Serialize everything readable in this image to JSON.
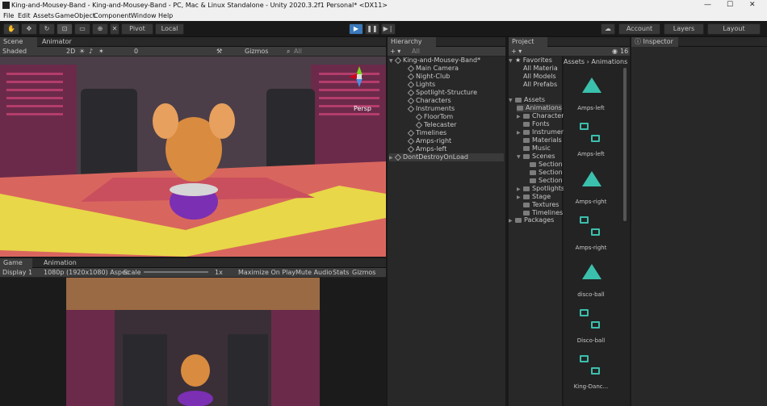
{
  "window": {
    "title": "King-and-Mousey-Band - King-and-Mousey-Band - PC, Mac & Linux Standalone - Unity 2020.3.2f1 Personal* <DX11>",
    "minimize": "—",
    "maximize": "☐",
    "close": "✕"
  },
  "menu": [
    "File",
    "Edit",
    "Assets",
    "GameObject",
    "Component",
    "Window",
    "Help"
  ],
  "toolbar": {
    "pivot": "Pivot",
    "local": "Local",
    "account": "Account",
    "layers": "Layers",
    "layout": "Layout"
  },
  "scene": {
    "tabs": [
      "Scene",
      "Animator"
    ],
    "shading": "Shaded",
    "mode_2d": "2D",
    "fx_count": "0",
    "gizmos": "Gizmos",
    "search_all": "All",
    "persp": "Persp"
  },
  "game": {
    "tabs": [
      "Game",
      "Animation"
    ],
    "display": "Display 1",
    "resolution": "1080p (1920x1080) Aspec",
    "scale_label": "Scale",
    "scale_value": "1x",
    "maximize": "Maximize On Play",
    "mute": "Mute Audio",
    "stats": "Stats",
    "gizmos": "Gizmos"
  },
  "hierarchy": {
    "tab": "Hierarchy",
    "search": "All",
    "items": [
      {
        "label": "King-and-Mousey-Band*",
        "depth": 0,
        "kind": "scene"
      },
      {
        "label": "Main Camera",
        "depth": 1,
        "kind": "go"
      },
      {
        "label": "Night-Club",
        "depth": 1,
        "kind": "go"
      },
      {
        "label": "Lights",
        "depth": 1,
        "kind": "go"
      },
      {
        "label": "Spotlight-Structure",
        "depth": 1,
        "kind": "go"
      },
      {
        "label": "Characters",
        "depth": 1,
        "kind": "go"
      },
      {
        "label": "Instruments",
        "depth": 1,
        "kind": "go"
      },
      {
        "label": "FloorTom",
        "depth": 2,
        "kind": "go"
      },
      {
        "label": "Telecaster",
        "depth": 2,
        "kind": "go"
      },
      {
        "label": "Timelines",
        "depth": 1,
        "kind": "go"
      },
      {
        "label": "Amps-right",
        "depth": 1,
        "kind": "go"
      },
      {
        "label": "Amps-left",
        "depth": 1,
        "kind": "go"
      },
      {
        "label": "DontDestroyOnLoad",
        "depth": 0,
        "kind": "scene"
      }
    ]
  },
  "project": {
    "tab": "Project",
    "count": "16",
    "breadcrumb": [
      "Assets",
      "Animations"
    ],
    "favorites": {
      "label": "Favorites",
      "items": [
        "All Materia",
        "All Models",
        "All Prefabs"
      ]
    },
    "assets": {
      "label": "Assets",
      "folders": [
        {
          "label": "Animations",
          "depth": 1
        },
        {
          "label": "Characters",
          "depth": 1
        },
        {
          "label": "Fonts",
          "depth": 1
        },
        {
          "label": "Instrument",
          "depth": 1
        },
        {
          "label": "Materials",
          "depth": 1
        },
        {
          "label": "Music",
          "depth": 1
        },
        {
          "label": "Scenes",
          "depth": 1
        },
        {
          "label": "Section",
          "depth": 2
        },
        {
          "label": "Section",
          "depth": 2
        },
        {
          "label": "Section",
          "depth": 2
        },
        {
          "label": "Spotlights",
          "depth": 1
        },
        {
          "label": "Stage",
          "depth": 1
        },
        {
          "label": "Textures",
          "depth": 1
        },
        {
          "label": "Timelines",
          "depth": 1
        }
      ]
    },
    "packages": "Packages",
    "grid": [
      {
        "label": "Amps-left",
        "kind": "clip"
      },
      {
        "label": "Amps-left",
        "kind": "controller"
      },
      {
        "label": "Amps-right",
        "kind": "clip"
      },
      {
        "label": "Amps-right",
        "kind": "controller"
      },
      {
        "label": "disco-ball",
        "kind": "clip"
      },
      {
        "label": "Disco-ball",
        "kind": "controller"
      },
      {
        "label": "King-Danc...",
        "kind": "controller"
      }
    ]
  },
  "inspector": {
    "tab": "Inspector"
  },
  "colors": {
    "accent": "#3a79bb",
    "asset": "#3bc0ad",
    "folder": "#c2a24a"
  }
}
